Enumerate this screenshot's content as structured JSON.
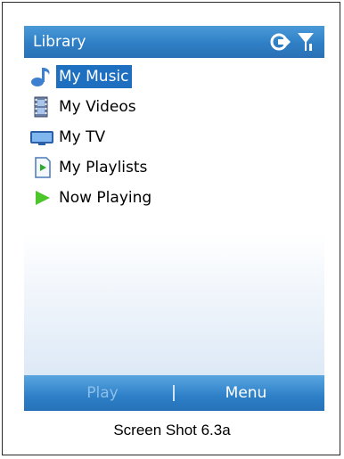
{
  "window": {
    "title": "Library"
  },
  "status_icons": [
    "sync-icon",
    "signal-icon"
  ],
  "menu": {
    "items": [
      {
        "label": "My Music",
        "icon": "music-note-icon",
        "selected": true
      },
      {
        "label": "My Videos",
        "icon": "film-strip-icon",
        "selected": false
      },
      {
        "label": "My TV",
        "icon": "tv-icon",
        "selected": false
      },
      {
        "label": "My Playlists",
        "icon": "playlist-icon",
        "selected": false
      },
      {
        "label": "Now Playing",
        "icon": "play-icon",
        "selected": false
      }
    ]
  },
  "softkeys": {
    "left_label": "Play",
    "right_label": "Menu"
  },
  "caption": "Screen Shot 6.3a",
  "colors": {
    "accent": "#2f7fc6",
    "selection": "#1f6fc0",
    "disabled_softkey": "#8cbfe9"
  }
}
